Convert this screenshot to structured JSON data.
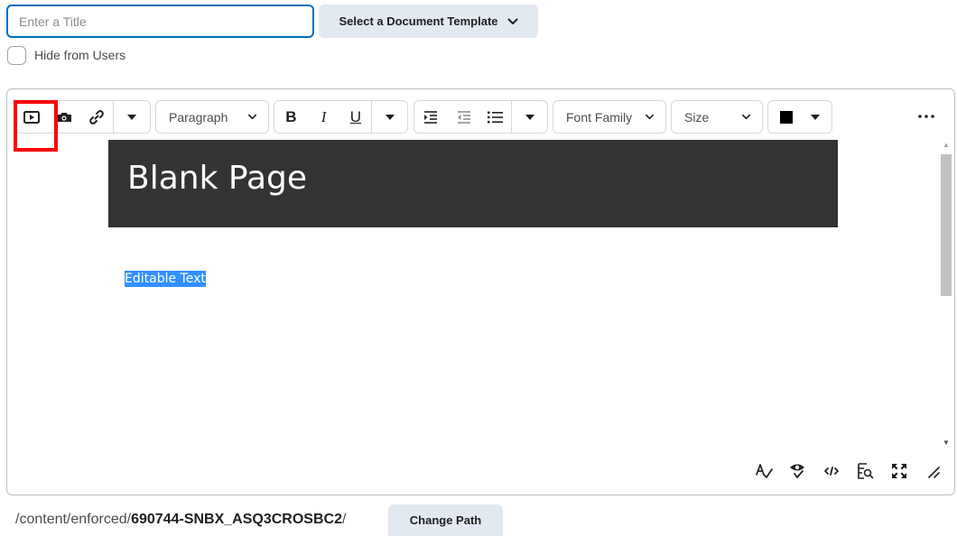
{
  "title_field": {
    "placeholder": "Enter a Title",
    "value": ""
  },
  "template_button": {
    "label": "Select a Document Template",
    "icon": "chevron-down-icon"
  },
  "hide_checkbox": {
    "label": "Hide from Users",
    "checked": false
  },
  "toolbar": {
    "insert_group": [
      "video-icon",
      "image-icon",
      "link-icon",
      "caret-down-icon"
    ],
    "format_dropdown": {
      "label": "Paragraph",
      "icon": "chevron-down-icon"
    },
    "text_style": {
      "bold": "B",
      "italic": "I",
      "underline": "U"
    },
    "list_group": [
      "indent-icon",
      "outdent-icon",
      "bullet-list-icon",
      "caret-down-icon"
    ],
    "font_family_dropdown": {
      "label": "Font Family",
      "icon": "chevron-down-icon"
    },
    "size_dropdown": {
      "label": "Size",
      "icon": "chevron-down-icon"
    },
    "color_picker": {
      "color": "#000000",
      "icon": "caret-down-icon"
    },
    "more_icon": "more-icon"
  },
  "content": {
    "heading": "Blank Page",
    "editable_text": "Editable Text"
  },
  "status_bar_icons": [
    "spellcheck-icon",
    "accessibility-check-icon",
    "source-code-icon",
    "preview-icon",
    "fullscreen-icon",
    "resize-handle-icon"
  ],
  "path": {
    "prefix": "/content/enforced/",
    "folder": "690744-SNBX_ASQ3CROSBC2",
    "suffix": "/",
    "change_button": "Change Path"
  },
  "colors": {
    "accent": "#006fbf",
    "button_bg": "#e3e9f1",
    "header_bg": "#333333",
    "selection": "#3390ff",
    "highlight_box": "#ff0000"
  }
}
